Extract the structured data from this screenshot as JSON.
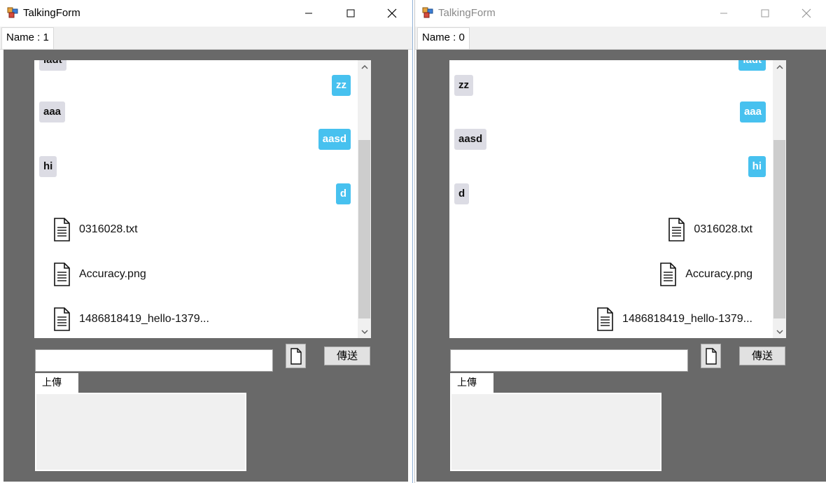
{
  "colors": {
    "window_bg": "#ffffff",
    "client_area": "#696969",
    "sent_bubble": "#47c1ef",
    "received_bubble": "#dcdce4",
    "scroll_thumb": "#cdcdcd"
  },
  "windows": [
    {
      "title": "TalkingForm",
      "active": true,
      "tab_label": "Name : 1",
      "messages": [
        {
          "text": "ladt",
          "side": "left"
        },
        {
          "text": "zz",
          "side": "right"
        },
        {
          "text": "aaa",
          "side": "left"
        },
        {
          "text": "aasd",
          "side": "right"
        },
        {
          "text": "hi",
          "side": "left"
        },
        {
          "text": "d",
          "side": "right"
        }
      ],
      "files": [
        {
          "name": "0316028.txt",
          "side": "left"
        },
        {
          "name": "Accuracy.png",
          "side": "left"
        },
        {
          "name": "1486818419_hello-1379...",
          "side": "left"
        }
      ],
      "input_value": "",
      "file_button_icon": "document-icon",
      "send_label": "傳送",
      "upload_tab_label": "上傳"
    },
    {
      "title": "TalkingForm",
      "active": false,
      "tab_label": "Name : 0",
      "messages": [
        {
          "text": "ladt",
          "side": "right"
        },
        {
          "text": "zz",
          "side": "left"
        },
        {
          "text": "aaa",
          "side": "right"
        },
        {
          "text": "aasd",
          "side": "left"
        },
        {
          "text": "hi",
          "side": "right"
        },
        {
          "text": "d",
          "side": "left"
        }
      ],
      "files": [
        {
          "name": "0316028.txt",
          "side": "right"
        },
        {
          "name": "Accuracy.png",
          "side": "right"
        },
        {
          "name": "1486818419_hello-1379...",
          "side": "right"
        }
      ],
      "input_value": "",
      "file_button_icon": "document-icon",
      "send_label": "傳送",
      "upload_tab_label": "上傳"
    }
  ]
}
